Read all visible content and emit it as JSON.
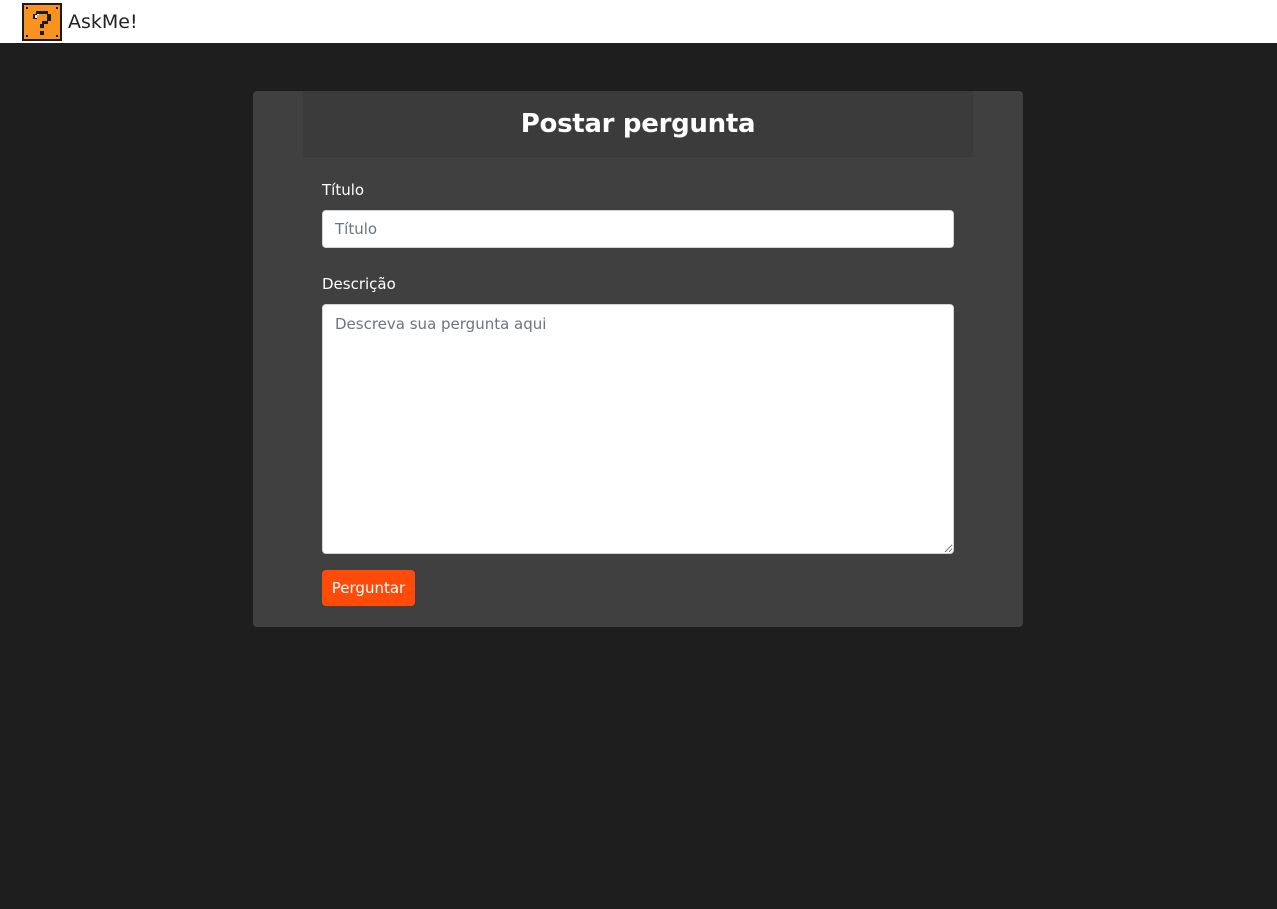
{
  "navbar": {
    "brand_name": "AskMe!",
    "logo_icon": "question-block-icon",
    "logo_colors": {
      "fill": "#f7931e",
      "border": "#1a1a1a",
      "mark": "#1a1a1a"
    }
  },
  "form": {
    "heading": "Postar pergunta",
    "title_label": "Título",
    "title_placeholder": "Título",
    "title_value": "",
    "description_label": "Descrição",
    "description_placeholder": "Descreva sua pergunta aqui",
    "description_value": "",
    "submit_label": "Perguntar"
  },
  "colors": {
    "page_background": "#1e1e1e",
    "card_background": "#404040",
    "accent": "#ff4b0a"
  }
}
